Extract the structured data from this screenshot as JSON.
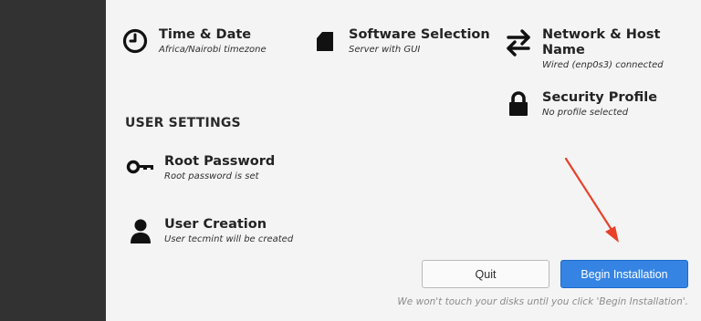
{
  "spokes": {
    "time_date": {
      "title": "Time & Date",
      "subtitle": "Africa/Nairobi timezone",
      "icon": "clock-icon"
    },
    "software_selection": {
      "title": "Software Selection",
      "subtitle": "Server with GUI",
      "icon": "package-icon"
    },
    "network_host": {
      "title_line1": "Network & Host",
      "title_line2": "Name",
      "subtitle": "Wired (enp0s3) connected",
      "icon": "network-arrows-icon"
    },
    "security_profile": {
      "title": "Security Profile",
      "subtitle": "No profile selected",
      "icon": "lock-icon"
    }
  },
  "user_settings": {
    "heading": "USER SETTINGS",
    "root_password": {
      "title": "Root Password",
      "subtitle": "Root password is set",
      "icon": "key-icon"
    },
    "user_creation": {
      "title": "User Creation",
      "subtitle": "User tecmint will be created",
      "icon": "user-icon"
    }
  },
  "actions": {
    "quit_label": "Quit",
    "begin_label": "Begin Installation",
    "note": "We won't touch your disks until you click 'Begin Installation'."
  },
  "colors": {
    "sidebar": "#323232",
    "accent_button": "#3584e4",
    "annotation_arrow": "#e8412a"
  }
}
